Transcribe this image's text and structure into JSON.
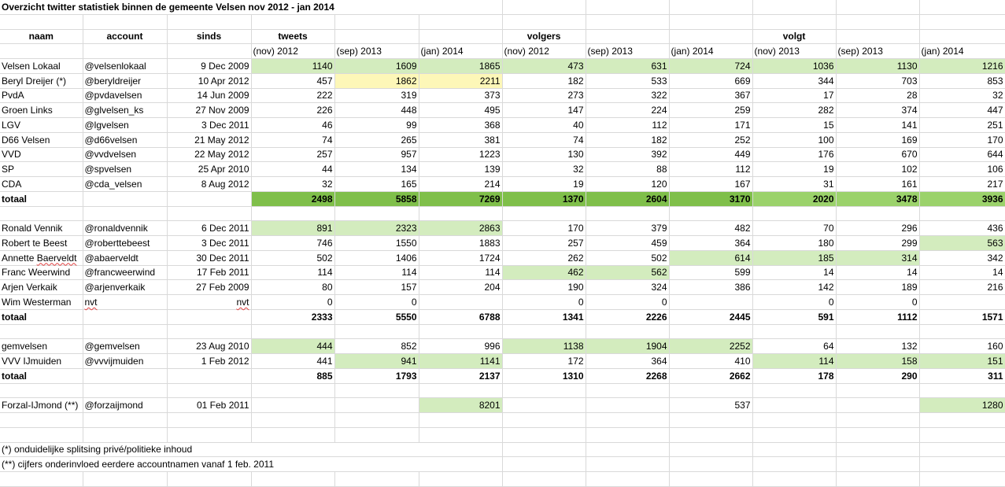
{
  "title": "Overzicht twitter statistiek binnen de gemeente Velsen nov 2012 - jan 2014",
  "headers": {
    "naam": "naam",
    "account": "account",
    "sinds": "sinds",
    "tweets": "tweets",
    "volgers": "volgers",
    "volgt": "volgt",
    "periods": [
      "(nov) 2012",
      "(sep) 2013",
      "(jan) 2014",
      "(nov) 2012",
      "(sep) 2013",
      "(jan) 2014",
      "(nov) 2013",
      "(sep) 2013",
      "(jan) 2014"
    ]
  },
  "colors": {
    "light_green": "#d3ecbe",
    "medium_green": "#9bd26b",
    "dark_green": "#7fbf4a",
    "yellow": "#fdf7b8"
  },
  "group1": [
    {
      "naam": "Velsen Lokaal",
      "account": "@velsenlokaal",
      "sinds": "9 Dec 2009",
      "v": [
        "1140",
        "1609",
        "1865",
        "473",
        "631",
        "724",
        "1036",
        "1130",
        "1216"
      ]
    },
    {
      "naam": "Beryl Dreijer (*)",
      "account": "@beryldreijer",
      "sinds": "10 Apr 2012",
      "v": [
        "457",
        "1862",
        "2211",
        "182",
        "533",
        "669",
        "344",
        "703",
        "853"
      ]
    },
    {
      "naam": "PvdA",
      "account": "@pvdavelsen",
      "sinds": "14 Jun 2009",
      "v": [
        "222",
        "319",
        "373",
        "273",
        "322",
        "367",
        "17",
        "28",
        "32"
      ]
    },
    {
      "naam": "Groen Links",
      "account": "@glvelsen_ks",
      "sinds": "27 Nov 2009",
      "v": [
        "226",
        "448",
        "495",
        "147",
        "224",
        "259",
        "282",
        "374",
        "447"
      ]
    },
    {
      "naam": "LGV",
      "account": "@lgvelsen",
      "sinds": "3 Dec 2011",
      "v": [
        "46",
        "99",
        "368",
        "40",
        "112",
        "171",
        "15",
        "141",
        "251"
      ]
    },
    {
      "naam": "D66 Velsen",
      "account": "@d66velsen",
      "sinds": "21 May 2012",
      "v": [
        "74",
        "265",
        "381",
        "74",
        "182",
        "252",
        "100",
        "169",
        "170"
      ]
    },
    {
      "naam": "VVD",
      "account": "@vvdvelsen",
      "sinds": "22 May 2012",
      "v": [
        "257",
        "957",
        "1223",
        "130",
        "392",
        "449",
        "176",
        "670",
        "644"
      ]
    },
    {
      "naam": "SP",
      "account": "@spvelsen",
      "sinds": "25 Apr 2010",
      "v": [
        "44",
        "134",
        "139",
        "32",
        "88",
        "112",
        "19",
        "102",
        "106"
      ]
    },
    {
      "naam": "CDA",
      "account": "@cda_velsen",
      "sinds": "8 Aug 2012",
      "v": [
        "32",
        "165",
        "214",
        "19",
        "120",
        "167",
        "31",
        "161",
        "217"
      ]
    }
  ],
  "total1": {
    "label": "totaal",
    "v": [
      "2498",
      "5858",
      "7269",
      "1370",
      "2604",
      "3170",
      "2020",
      "3478",
      "3936"
    ]
  },
  "group2": [
    {
      "naam": "Ronald Vennik",
      "account": "@ronaldvennik",
      "sinds": "6 Dec 2011",
      "v": [
        "891",
        "2323",
        "2863",
        "170",
        "379",
        "482",
        "70",
        "296",
        "436"
      ]
    },
    {
      "naam": "Robert te Beest",
      "account": "@roberttebeest",
      "sinds": "3 Dec 2011",
      "v": [
        "746",
        "1550",
        "1883",
        "257",
        "459",
        "364",
        "180",
        "299",
        "563"
      ]
    },
    {
      "naam": "Annette Baerveldt",
      "account": "@abaerveldt",
      "sinds": "30 Dec 2011",
      "v": [
        "502",
        "1406",
        "1724",
        "262",
        "502",
        "614",
        "185",
        "314",
        "342"
      ]
    },
    {
      "naam": "Franc Weerwind",
      "account": "@francweerwind",
      "sinds": "17 Feb 2011",
      "v": [
        "114",
        "114",
        "114",
        "462",
        "562",
        "599",
        "14",
        "14",
        "14"
      ]
    },
    {
      "naam": "Arjen Verkaik",
      "account": "@arjenverkaik",
      "sinds": "27 Feb 2009",
      "v": [
        "80",
        "157",
        "204",
        "190",
        "324",
        "386",
        "142",
        "189",
        "216"
      ]
    },
    {
      "naam": "Wim Westerman",
      "account": "nvt",
      "sinds": "nvt",
      "v": [
        "0",
        "0",
        "",
        "0",
        "0",
        "",
        "0",
        "0",
        ""
      ]
    }
  ],
  "total2": {
    "label": "totaal",
    "v": [
      "2333",
      "5550",
      "6788",
      "1341",
      "2226",
      "2445",
      "591",
      "1112",
      "1571"
    ]
  },
  "group3": [
    {
      "naam": "gemvelsen",
      "account": "@gemvelsen",
      "sinds": "23 Aug 2010",
      "v": [
        "444",
        "852",
        "996",
        "1138",
        "1904",
        "2252",
        "64",
        "132",
        "160"
      ]
    },
    {
      "naam": "VVV IJmuiden",
      "account": "@vvvijmuiden",
      "sinds": "1 Feb 2012",
      "v": [
        "441",
        "941",
        "1141",
        "172",
        "364",
        "410",
        "114",
        "158",
        "151"
      ]
    }
  ],
  "total3": {
    "label": "totaal",
    "v": [
      "885",
      "1793",
      "2137",
      "1310",
      "2268",
      "2662",
      "178",
      "290",
      "311"
    ]
  },
  "forzal": {
    "naam": "Forzal-IJmond (**)",
    "account": "@forzaijmond",
    "sinds": "01 Feb 2011",
    "v": [
      "",
      "",
      "8201",
      "",
      "",
      "537",
      "",
      "",
      "1280"
    ]
  },
  "notes": [
    "(*) onduidelijke splitsing privé/politieke inhoud",
    "(**) cijfers onderinvloed eerdere accountnamen vanaf 1 feb. 2011"
  ]
}
